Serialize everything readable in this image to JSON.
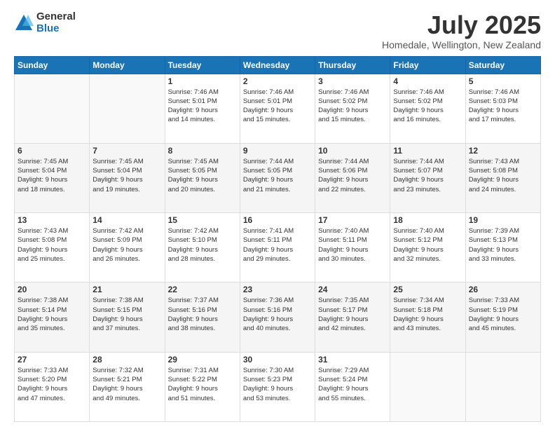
{
  "logo": {
    "general": "General",
    "blue": "Blue"
  },
  "title": "July 2025",
  "subtitle": "Homedale, Wellington, New Zealand",
  "days_of_week": [
    "Sunday",
    "Monday",
    "Tuesday",
    "Wednesday",
    "Thursday",
    "Friday",
    "Saturday"
  ],
  "weeks": [
    [
      {
        "day": "",
        "info": ""
      },
      {
        "day": "",
        "info": ""
      },
      {
        "day": "1",
        "info": "Sunrise: 7:46 AM\nSunset: 5:01 PM\nDaylight: 9 hours\nand 14 minutes."
      },
      {
        "day": "2",
        "info": "Sunrise: 7:46 AM\nSunset: 5:01 PM\nDaylight: 9 hours\nand 15 minutes."
      },
      {
        "day": "3",
        "info": "Sunrise: 7:46 AM\nSunset: 5:02 PM\nDaylight: 9 hours\nand 15 minutes."
      },
      {
        "day": "4",
        "info": "Sunrise: 7:46 AM\nSunset: 5:02 PM\nDaylight: 9 hours\nand 16 minutes."
      },
      {
        "day": "5",
        "info": "Sunrise: 7:46 AM\nSunset: 5:03 PM\nDaylight: 9 hours\nand 17 minutes."
      }
    ],
    [
      {
        "day": "6",
        "info": "Sunrise: 7:45 AM\nSunset: 5:04 PM\nDaylight: 9 hours\nand 18 minutes."
      },
      {
        "day": "7",
        "info": "Sunrise: 7:45 AM\nSunset: 5:04 PM\nDaylight: 9 hours\nand 19 minutes."
      },
      {
        "day": "8",
        "info": "Sunrise: 7:45 AM\nSunset: 5:05 PM\nDaylight: 9 hours\nand 20 minutes."
      },
      {
        "day": "9",
        "info": "Sunrise: 7:44 AM\nSunset: 5:05 PM\nDaylight: 9 hours\nand 21 minutes."
      },
      {
        "day": "10",
        "info": "Sunrise: 7:44 AM\nSunset: 5:06 PM\nDaylight: 9 hours\nand 22 minutes."
      },
      {
        "day": "11",
        "info": "Sunrise: 7:44 AM\nSunset: 5:07 PM\nDaylight: 9 hours\nand 23 minutes."
      },
      {
        "day": "12",
        "info": "Sunrise: 7:43 AM\nSunset: 5:08 PM\nDaylight: 9 hours\nand 24 minutes."
      }
    ],
    [
      {
        "day": "13",
        "info": "Sunrise: 7:43 AM\nSunset: 5:08 PM\nDaylight: 9 hours\nand 25 minutes."
      },
      {
        "day": "14",
        "info": "Sunrise: 7:42 AM\nSunset: 5:09 PM\nDaylight: 9 hours\nand 26 minutes."
      },
      {
        "day": "15",
        "info": "Sunrise: 7:42 AM\nSunset: 5:10 PM\nDaylight: 9 hours\nand 28 minutes."
      },
      {
        "day": "16",
        "info": "Sunrise: 7:41 AM\nSunset: 5:11 PM\nDaylight: 9 hours\nand 29 minutes."
      },
      {
        "day": "17",
        "info": "Sunrise: 7:40 AM\nSunset: 5:11 PM\nDaylight: 9 hours\nand 30 minutes."
      },
      {
        "day": "18",
        "info": "Sunrise: 7:40 AM\nSunset: 5:12 PM\nDaylight: 9 hours\nand 32 minutes."
      },
      {
        "day": "19",
        "info": "Sunrise: 7:39 AM\nSunset: 5:13 PM\nDaylight: 9 hours\nand 33 minutes."
      }
    ],
    [
      {
        "day": "20",
        "info": "Sunrise: 7:38 AM\nSunset: 5:14 PM\nDaylight: 9 hours\nand 35 minutes."
      },
      {
        "day": "21",
        "info": "Sunrise: 7:38 AM\nSunset: 5:15 PM\nDaylight: 9 hours\nand 37 minutes."
      },
      {
        "day": "22",
        "info": "Sunrise: 7:37 AM\nSunset: 5:16 PM\nDaylight: 9 hours\nand 38 minutes."
      },
      {
        "day": "23",
        "info": "Sunrise: 7:36 AM\nSunset: 5:16 PM\nDaylight: 9 hours\nand 40 minutes."
      },
      {
        "day": "24",
        "info": "Sunrise: 7:35 AM\nSunset: 5:17 PM\nDaylight: 9 hours\nand 42 minutes."
      },
      {
        "day": "25",
        "info": "Sunrise: 7:34 AM\nSunset: 5:18 PM\nDaylight: 9 hours\nand 43 minutes."
      },
      {
        "day": "26",
        "info": "Sunrise: 7:33 AM\nSunset: 5:19 PM\nDaylight: 9 hours\nand 45 minutes."
      }
    ],
    [
      {
        "day": "27",
        "info": "Sunrise: 7:33 AM\nSunset: 5:20 PM\nDaylight: 9 hours\nand 47 minutes."
      },
      {
        "day": "28",
        "info": "Sunrise: 7:32 AM\nSunset: 5:21 PM\nDaylight: 9 hours\nand 49 minutes."
      },
      {
        "day": "29",
        "info": "Sunrise: 7:31 AM\nSunset: 5:22 PM\nDaylight: 9 hours\nand 51 minutes."
      },
      {
        "day": "30",
        "info": "Sunrise: 7:30 AM\nSunset: 5:23 PM\nDaylight: 9 hours\nand 53 minutes."
      },
      {
        "day": "31",
        "info": "Sunrise: 7:29 AM\nSunset: 5:24 PM\nDaylight: 9 hours\nand 55 minutes."
      },
      {
        "day": "",
        "info": ""
      },
      {
        "day": "",
        "info": ""
      }
    ]
  ]
}
